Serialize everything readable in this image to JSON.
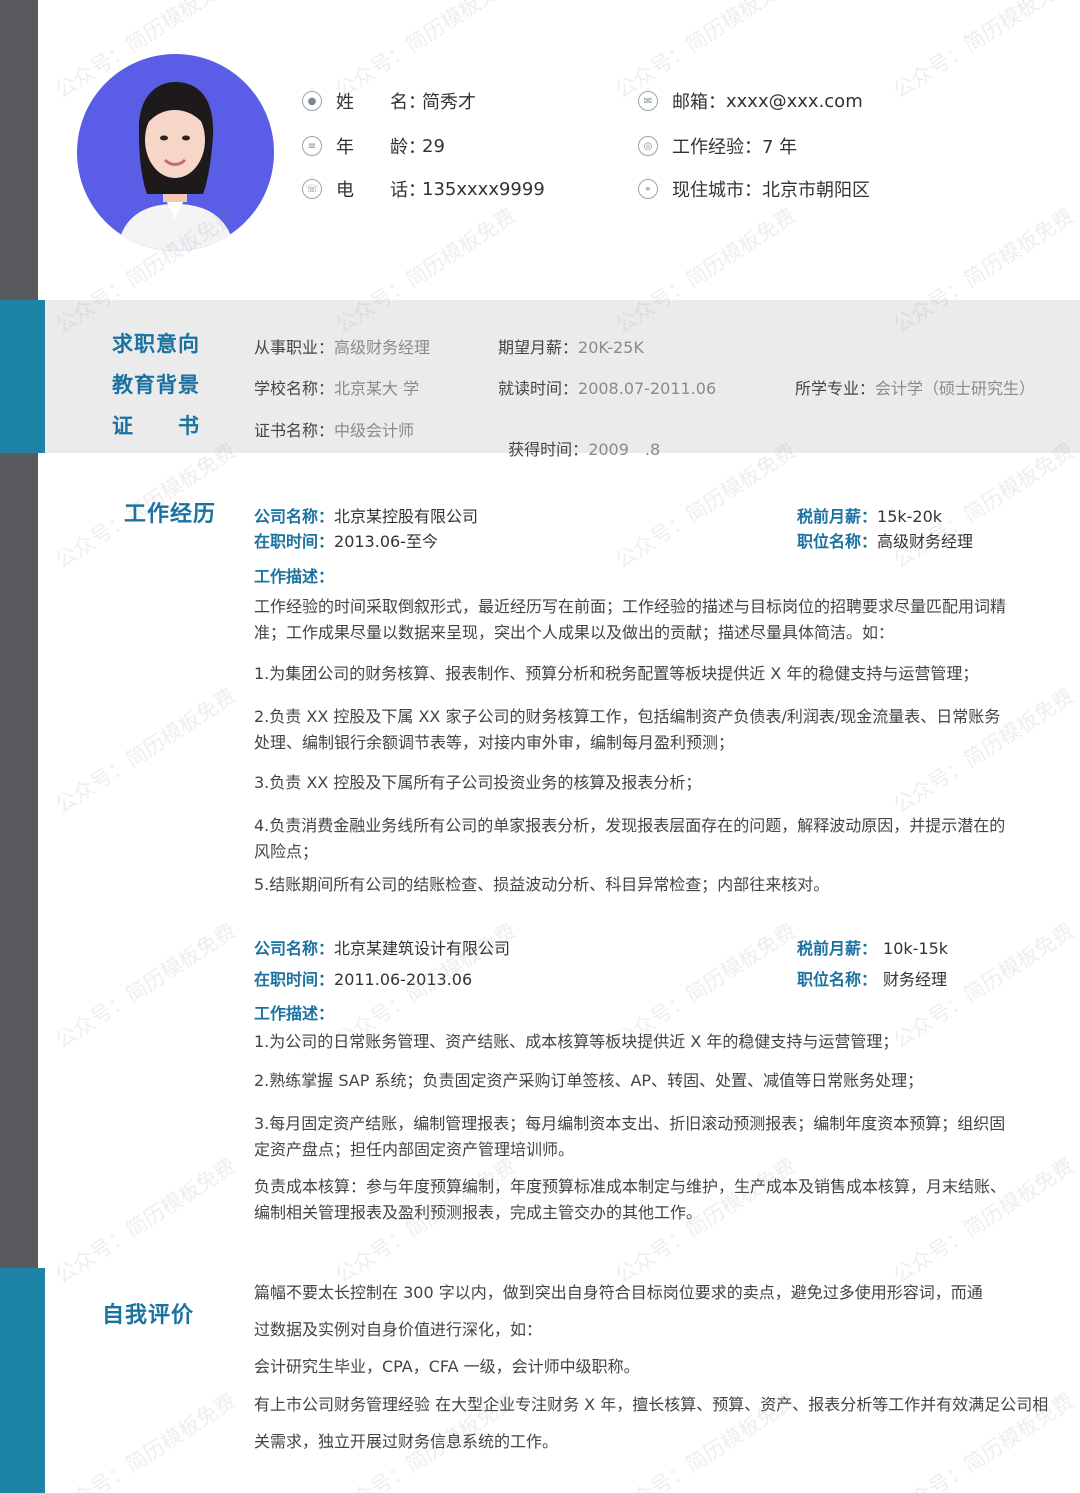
{
  "watermark": "公众号：简历模板免费",
  "profile": {
    "name_label": "姓　　名：",
    "name": "简秀才",
    "age_label": "年　　龄：",
    "age": "29",
    "phone_label": "电　　话：",
    "phone": "135xxxx9999",
    "email_label": "邮箱：",
    "email": "xxxx@xxx.com",
    "experience_label": "工作经验：",
    "experience": "7 年",
    "city_label": "现住城市：",
    "city": "北京市朝阳区"
  },
  "intent": {
    "title": "求职意向",
    "job_label": "从事职业：",
    "job": "高级财务经理",
    "salary_label": "期望月薪：",
    "salary": "20K-25K"
  },
  "education": {
    "title": "教育背景",
    "school_label": "学校名称：",
    "school": "北京某大 学",
    "period_label": "就读时间：",
    "period": "2008.07-2011.06",
    "major_label": "所学专业：",
    "major": "会计学（硕士研究生）"
  },
  "certificate": {
    "title": "证　　书",
    "name_label": "证书名称：",
    "name": "中级会计师",
    "date_label": "获得时间：",
    "date": "2009　.8"
  },
  "work": {
    "title": "工作经历",
    "jobs": [
      {
        "company_label": "公司名称：",
        "company": "北京某控股有限公司",
        "salary_label": "税前月薪：",
        "salary": "15k-20k",
        "period_label": "在职时间：",
        "period": "2013.06-至今",
        "position_label": "职位名称：",
        "position": "高级财务经理",
        "desc_label": "工作描述：",
        "items": [
          "工作经验的时间采取倒叙形式，最近经历写在前面；工作经验的描述与目标岗位的招聘要求尽量匹配用词精准；工作成果尽量以数据来呈现，突出个人成果以及做出的贡献；描述尽量具体简洁。如：",
          "1.为集团公司的财务核算、报表制作、预算分析和税务配置等板块提供近 X 年的稳健支持与运营管理；",
          "2.负责 XX 控股及下属 XX 家子公司的财务核算工作，包括编制资产负债表/利润表/现金流量表、日常账务处理、编制银行余额调节表等，对接内审外审，编制每月盈利预测；",
          "3.负责 XX 控股及下属所有子公司投资业务的核算及报表分析；",
          "4.负责消费金融业务线所有公司的单家报表分析，发现报表层面存在的问题，解释波动原因，并提示潜在的风险点；",
          "5.结账期间所有公司的结账检查、损益波动分析、科目异常检查；内部往来核对。"
        ]
      },
      {
        "company_label": "公司名称：",
        "company": "北京某建筑设计有限公司",
        "salary_label": "税前月薪：",
        "salary": "10k-15k",
        "period_label": "在职时间：",
        "period": "2011.06-2013.06",
        "position_label": "职位名称：",
        "position": "财务经理",
        "desc_label": "工作描述：",
        "items": [
          "1.为公司的日常账务管理、资产结账、成本核算等板块提供近 X 年的稳健支持与运营管理；",
          "2.熟练掌握 SAP 系统；负责固定资产采购订单签核、AP、转固、处置、减值等日常账务处理；",
          "3.每月固定资产结账，编制管理报表；每月编制资本支出、折旧滚动预测报表；编制年度资本预算；组织固定资产盘点；担任内部固定资产管理培训师。",
          "负责成本核算：参与年度预算编制，年度预算标准成本制定与维护，生产成本及销售成本核算，月末结账、编制相关管理报表及盈利预测报表，完成主管交办的其他工作。"
        ]
      }
    ]
  },
  "self_eval": {
    "title": "自我评价",
    "lines": [
      "篇幅不要太长控制在 300 字以内，做到突出自身符合目标岗位要求的卖点，避免过多使用形容词，而通",
      "过数据及实例对自身价值进行深化，如：",
      "会计研究生毕业，CPA，CFA 一级，会计师中级职称。",
      "有上市公司财务管理经验 在大型企业专注财务 X 年，擅长核算、预算、资产、报表分析等工作并有效满足公司相",
      "关需求，独立开展过财务信息系统的工作。"
    ]
  }
}
